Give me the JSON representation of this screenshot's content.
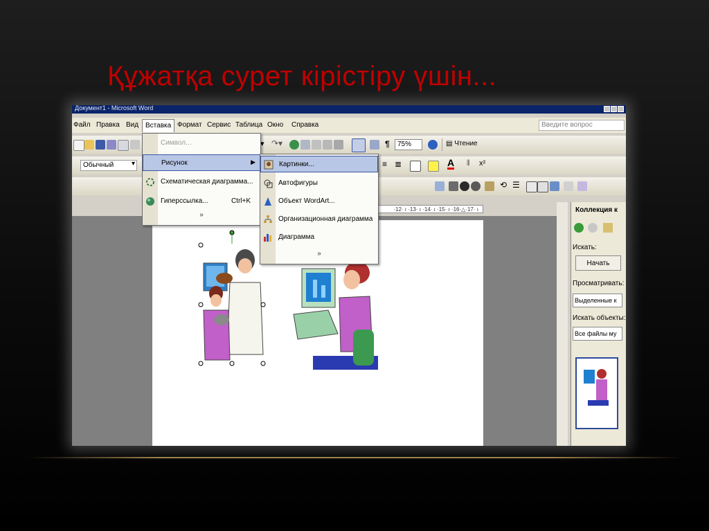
{
  "slide": {
    "title": "Құжатқа сурет кірістіру үшін..."
  },
  "window": {
    "title": "Документ1 - Microsoft Word"
  },
  "menubar": {
    "items": [
      "Файл",
      "Правка",
      "Вид",
      "Вставка",
      "Формат",
      "Сервис",
      "Таблица",
      "Окно",
      "Справка"
    ],
    "active": "Вставка",
    "ask_placeholder": "Введите вопрос"
  },
  "toolbar": {
    "zoom": "75%",
    "reading": "Чтение",
    "style": "Обычный"
  },
  "insert_menu": {
    "items": [
      "Символ...",
      "Рисунок",
      "Схематическая диаграмма...",
      "Гиперссылка..."
    ],
    "hyperlink_shortcut": "Ctrl+K",
    "expand": "»"
  },
  "picture_submenu": {
    "items": [
      "Картинки...",
      "Автофигуры",
      "Объект WordArt...",
      "Организационная диаграмма",
      "Диаграмма"
    ],
    "expand": "»"
  },
  "ruler": {
    "text": "·12· ı ·13· ı ·14· ı ·15· ı ·16·△·17· ı"
  },
  "taskpane": {
    "title": "Коллекция к",
    "search_label": "Искать:",
    "search_button": "Начать",
    "browse_label": "Просматривать:",
    "browse_value": "Выделенные к",
    "objects_label": "Искать объекты:",
    "objects_value": "Все файлы му"
  },
  "colors": {
    "title": "#c00000",
    "menu_highlight": "#b8c7e6",
    "titlebar": "#0a246a"
  }
}
